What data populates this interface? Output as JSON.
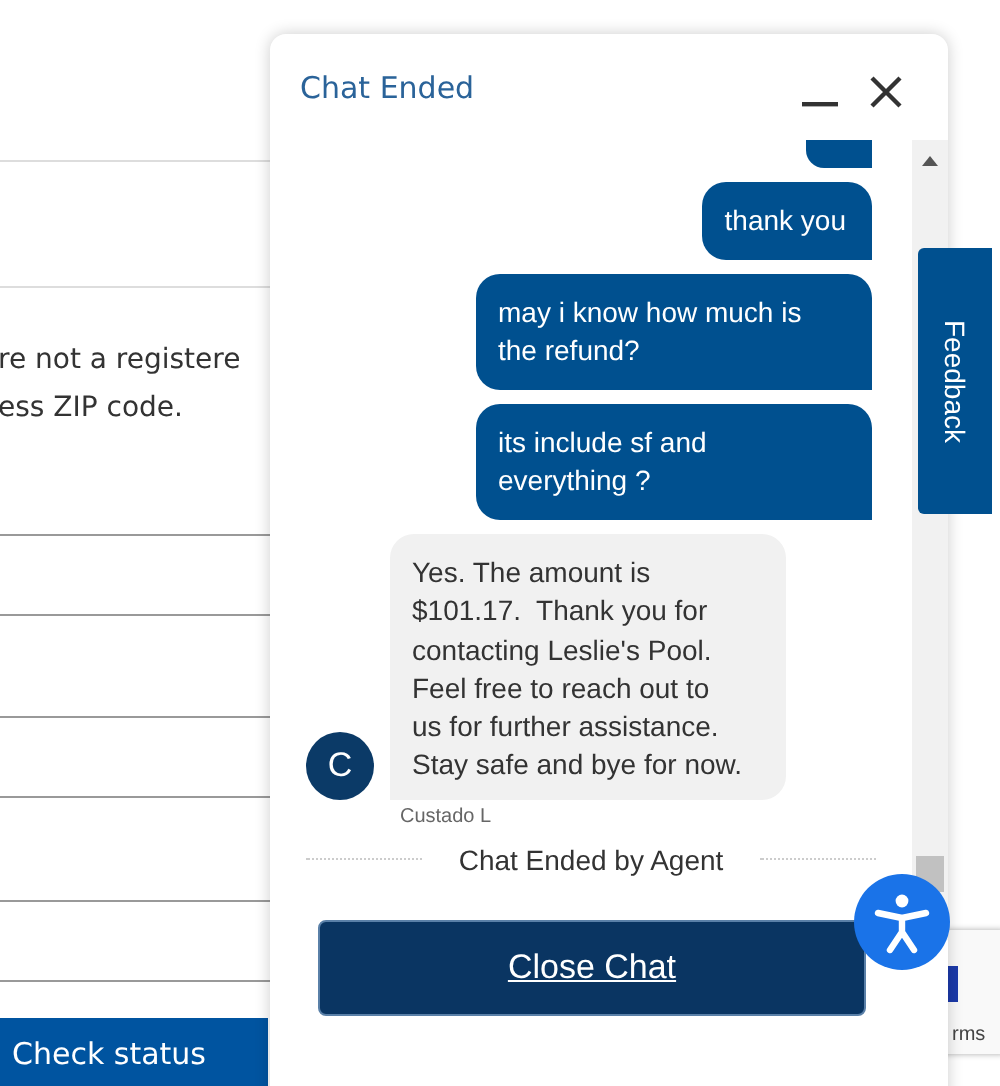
{
  "background_page": {
    "text_lines": [
      "re not a registere",
      "ess ZIP code."
    ],
    "check_status_button": "Check status",
    "recaptcha_text": "rms"
  },
  "chat": {
    "title": "Chat Ended",
    "messages": [
      {
        "kind": "user_cut"
      },
      {
        "kind": "user",
        "text": "thank you"
      },
      {
        "kind": "user",
        "text": "may i know how much is\nthe refund?"
      },
      {
        "kind": "user",
        "text": "its include sf and\neverything ?"
      },
      {
        "kind": "agent",
        "text": "Yes. The amount is\n$101.17.  Thank you for\ncontacting Leslie's Pool.\nFeel free to reach out to\nus for further assistance.\nStay safe and bye for now.",
        "avatar": "C",
        "sender_name": "Custado L"
      }
    ],
    "status": "Chat Ended by Agent",
    "close_button": "Close Chat"
  },
  "feedback_tab": "Feedback"
}
